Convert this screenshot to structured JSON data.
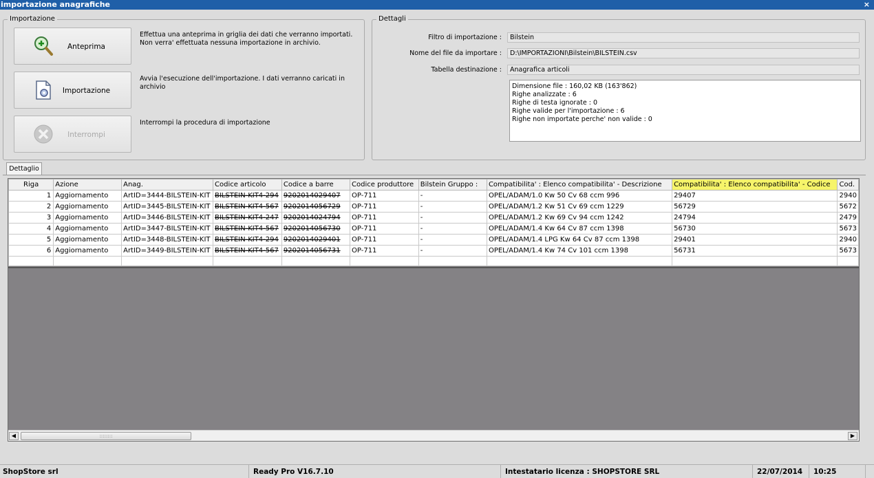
{
  "window": {
    "title": "importazione anagrafiche",
    "close_glyph": "×"
  },
  "importazione": {
    "legend": "Importazione",
    "anteprima": {
      "label": "Anteprima",
      "icon": "magnifier-plus-icon",
      "description": "Effettua una anteprima in griglia dei dati che verranno importati. Non verra' effettuata nessuna importazione in archivio."
    },
    "importazione": {
      "label": "Importazione",
      "icon": "document-gear-icon",
      "description": "Avvia l'esecuzione dell'importazione. I dati verranno caricati in archivio"
    },
    "interrompi": {
      "label": "Interrompi",
      "icon": "stop-x-icon",
      "description": "Interrompi la procedura di importazione",
      "disabled": true
    }
  },
  "dettagli": {
    "legend": "Dettagli",
    "filtro_label": "Filtro di importazione :",
    "filtro_value": "Bilstein",
    "file_label": "Nome del file da importare :",
    "file_value": "D:\\IMPORTAZIONI\\Bilstein\\BILSTEIN.csv",
    "tabella_label": "Tabella destinazione :",
    "tabella_value": "Anagrafica articoli",
    "info_lines": [
      "Dimensione file : 160,02 KB (163'862)",
      "Righe analizzate : 6",
      "Righe di testa ignorate : 0",
      "Righe valide per l'importazione : 6",
      "Righe non importate perche' non valide : 0"
    ]
  },
  "tab": {
    "label": "Dettaglio"
  },
  "grid": {
    "columns": [
      "Riga",
      "Azione",
      "Anag.",
      "Codice articolo",
      "Codice a barre",
      "Codice produttore",
      "Bilstein Gruppo :",
      "Compatibilita' : Elenco compatibilita' - Descrizione",
      "Compatibilita' : Elenco compatibilita' - Codice",
      "Cod."
    ],
    "rows": [
      [
        "1",
        "Aggiornamento",
        "ArtID=3444-BILSTEIN-KIT",
        "BILSTEIN-KIT4-294",
        "9202014029407",
        "OP-711",
        "-",
        "OPEL/ADAM/1.0 Kw 50 Cv 68 ccm 996",
        "29407",
        "2940"
      ],
      [
        "2",
        "Aggiornamento",
        "ArtID=3445-BILSTEIN-KIT",
        "BILSTEIN-KIT4-567",
        "9202014056729",
        "OP-711",
        "-",
        "OPEL/ADAM/1.2 Kw 51 Cv 69 ccm 1229",
        "56729",
        "5672"
      ],
      [
        "3",
        "Aggiornamento",
        "ArtID=3446-BILSTEIN-KIT",
        "BILSTEIN-KIT4-247",
        "9202014024794",
        "OP-711",
        "-",
        "OPEL/ADAM/1.2 Kw 69 Cv 94 ccm 1242",
        "24794",
        "2479"
      ],
      [
        "4",
        "Aggiornamento",
        "ArtID=3447-BILSTEIN-KIT",
        "BILSTEIN-KIT4-567",
        "9202014056730",
        "OP-711",
        "-",
        "OPEL/ADAM/1.4 Kw 64 Cv 87 ccm 1398",
        "56730",
        "5673"
      ],
      [
        "5",
        "Aggiornamento",
        "ArtID=3448-BILSTEIN-KIT",
        "BILSTEIN-KIT4-294",
        "9202014029401",
        "OP-711",
        "-",
        "OPEL/ADAM/1.4 LPG Kw 64 Cv 87 ccm 1398",
        "29401",
        "2940"
      ],
      [
        "6",
        "Aggiornamento",
        "ArtID=3449-BILSTEIN-KIT",
        "BILSTEIN-KIT4-567",
        "9202014056731",
        "OP-711",
        "-",
        "OPEL/ADAM/1.4 Kw 74 Cv 101 ccm 1398",
        "56731",
        "5673"
      ]
    ],
    "scroll": {
      "left_arrow": "◀",
      "right_arrow": "▶",
      "thumb_grip": "::::::::"
    }
  },
  "status": {
    "company": "ShopStore srl",
    "version": "Ready Pro V16.7.10",
    "license": "Intestatario licenza : SHOPSTORE SRL",
    "date": "22/07/2014",
    "time": "10:25"
  },
  "colors": {
    "title_bar": "#1f5fa8",
    "highlight_header": "#f6f46a",
    "grid_empty": "#848285"
  }
}
